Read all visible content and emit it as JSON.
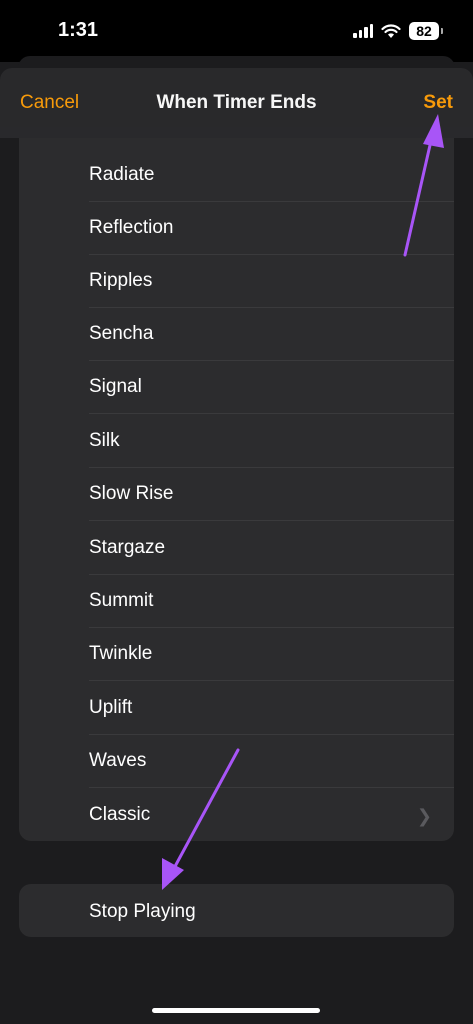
{
  "status_bar": {
    "time": "1:31",
    "battery": "82"
  },
  "nav": {
    "cancel_label": "Cancel",
    "title": "When Timer Ends",
    "set_label": "Set"
  },
  "tones": [
    {
      "label": "Radiate"
    },
    {
      "label": "Reflection"
    },
    {
      "label": "Ripples"
    },
    {
      "label": "Sencha"
    },
    {
      "label": "Signal"
    },
    {
      "label": "Silk"
    },
    {
      "label": "Slow Rise"
    },
    {
      "label": "Stargaze"
    },
    {
      "label": "Summit"
    },
    {
      "label": "Twinkle"
    },
    {
      "label": "Uplift"
    },
    {
      "label": "Waves"
    },
    {
      "label": "Classic"
    }
  ],
  "stop": {
    "label": "Stop Playing"
  },
  "colors": {
    "accent": "#ff9f0a",
    "annotation": "#a855f7",
    "background": "#1c1c1e",
    "cell": "#2c2c2e"
  }
}
